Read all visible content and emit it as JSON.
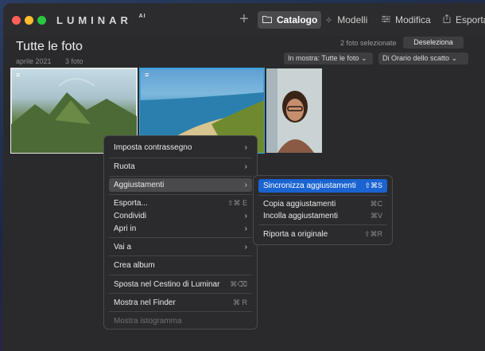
{
  "app": {
    "name": "LUMINAR",
    "name_suffix": "AI"
  },
  "toolbar": {
    "plus_label": "+",
    "tabs": [
      {
        "label": "Catalogo",
        "icon": "folder-icon",
        "active": true
      },
      {
        "label": "Modelli",
        "icon": "sparkle-icon"
      },
      {
        "label": "Modifica",
        "icon": "sliders-icon"
      },
      {
        "label": "Esporta",
        "icon": "share-icon"
      }
    ]
  },
  "header": {
    "title": "Tutte le foto",
    "date": "aprile 2021",
    "count": "3 foto",
    "selected_info": "2 foto selezionate",
    "deselect_label": "Deseleziona",
    "filter_label": "In mostra: Tutte le foto",
    "sort_label": "Di Orario dello scatto"
  },
  "photos": [
    {
      "subject": "mountain-ruins",
      "selected": true
    },
    {
      "subject": "beach-coast",
      "selected": true
    },
    {
      "subject": "portrait-woman",
      "selected": false
    }
  ],
  "context_menu": {
    "items": [
      {
        "label": "Imposta contrassegno",
        "submenu": true
      },
      {
        "label": "Ruota",
        "submenu": true
      },
      {
        "label": "Aggiustamenti",
        "submenu": true,
        "highlighted": true
      },
      {
        "label": "Esporta...",
        "shortcut": "⇧⌘ E"
      },
      {
        "label": "Condividi",
        "submenu": true
      },
      {
        "label": "Apri in",
        "submenu": true
      },
      {
        "label": "Vai a",
        "submenu": true
      },
      {
        "label": "Crea album"
      },
      {
        "label": "Sposta nel Cestino di Luminar",
        "shortcut": "⌘⌫"
      },
      {
        "label": "Mostra nel Finder",
        "shortcut": "⌘ R"
      },
      {
        "label": "Mostra istogramma",
        "disabled": true
      }
    ]
  },
  "submenu": {
    "items": [
      {
        "label": "Sincronizza aggiustamenti",
        "shortcut": "⇧⌘S",
        "active": true
      },
      {
        "label": "Copia aggiustamenti",
        "shortcut": "⌘C"
      },
      {
        "label": "Incolla aggiustamenti",
        "shortcut": "⌘V"
      },
      {
        "label": "Riporta a originale",
        "shortcut": "⇧⌘R"
      }
    ]
  },
  "colors": {
    "accent": "#1a63d1",
    "selection_outline": "#3aa2e0"
  }
}
